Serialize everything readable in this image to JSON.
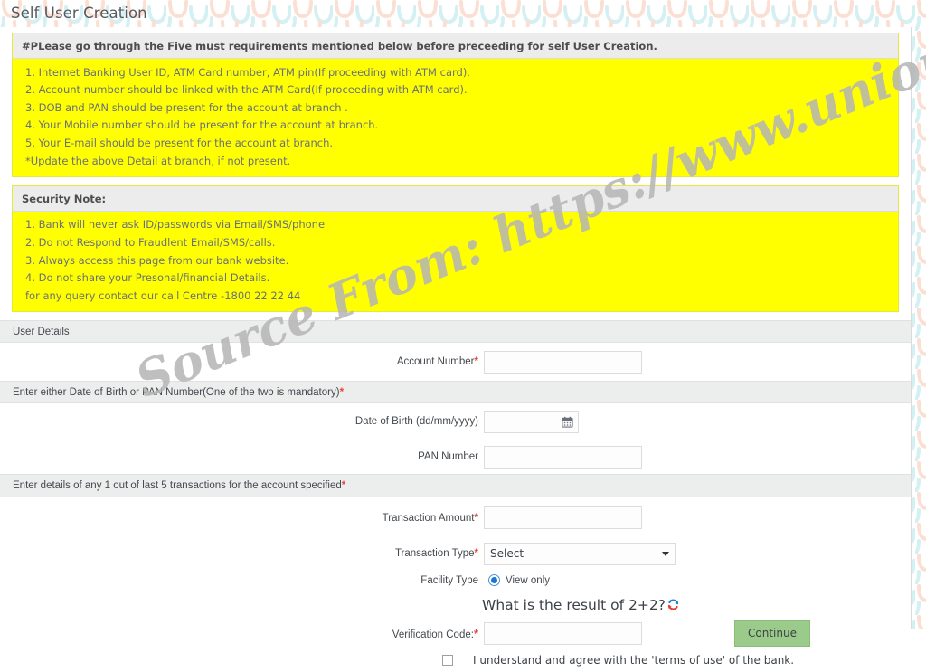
{
  "page": {
    "title": "Self User Creation",
    "watermark": "Source From: https://www.unionbankonline.co.in/"
  },
  "colors": {
    "notice_bg": "#ffff00",
    "notice_border": "#e8e83a",
    "notice_head_bg": "#ececec",
    "section_bar_bg": "#eceded",
    "required_star": "#e8433a",
    "continue_button": "#9bcb8a",
    "radio_selected": "#1976d2",
    "pattern_peach": "#fde4d8",
    "pattern_cyan": "#d6f2f3"
  },
  "requirements_notice": {
    "heading": "#PLease go through the Five must requirements mentioned below before preceeding for self User Creation.",
    "items": [
      "1. Internet Banking User ID, ATM Card number, ATM pin(If proceeding with ATM card).",
      "2. Account number should be linked with the ATM Card(If proceeding with ATM card).",
      "3. DOB and PAN should be present for the account at branch .",
      "4. Your Mobile number should be present for the account at branch.",
      "5. Your E-mail should be present for the account at branch.",
      "*Update the above Detail at branch, if not present."
    ]
  },
  "security_notice": {
    "heading": "Security Note:",
    "items": [
      "1. Bank will never ask ID/passwords via Email/SMS/phone",
      "2. Do not Respond to Fraudlent Email/SMS/calls.",
      "3. Always access this page from our bank website.",
      "4. Do not share your Presonal/financial Details.",
      "for any query contact our call Centre -1800 22 22 44"
    ]
  },
  "sections": {
    "user_details": {
      "bar_label": "User Details",
      "account_number": {
        "label": "Account Number",
        "required": "*",
        "value": "",
        "placeholder": ""
      }
    },
    "dob_pan": {
      "bar_label": "Enter either Date of Birth or PAN Number(One of the two is mandatory)",
      "bar_required": "*",
      "date_of_birth": {
        "label": "Date of Birth (dd/mm/yyyy)",
        "value": "",
        "placeholder": "",
        "icon": "calendar-icon"
      },
      "pan_number": {
        "label": "PAN Number",
        "value": "",
        "placeholder": ""
      }
    },
    "transactions": {
      "bar_label": "Enter details of any 1 out of last 5 transactions for the account specified",
      "bar_required": "*",
      "transaction_amount": {
        "label": "Transaction Amount",
        "required": "*",
        "value": "",
        "placeholder": ""
      },
      "transaction_type": {
        "label": "Transaction Type",
        "required": "*",
        "selected": "Select",
        "options": [
          "Select"
        ]
      },
      "facility_type": {
        "label": "Facility Type",
        "option_label": "View only",
        "checked": true
      },
      "captcha": {
        "question": "What is the result of 2+2?",
        "refresh_icon": "refresh-icon"
      },
      "verification_code": {
        "label": "Verification Code:",
        "required": "*",
        "value": "",
        "placeholder": ""
      },
      "terms": {
        "checked": false,
        "text": "I understand and agree with the 'terms of use' of the bank."
      },
      "continue_button": "Continue"
    }
  }
}
